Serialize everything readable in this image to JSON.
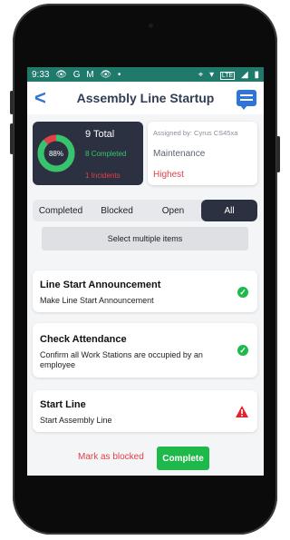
{
  "status_bar": {
    "time": "9:33",
    "left_icons": [
      "eye-icon",
      "google-icon",
      "gmail-icon",
      "eye-icon",
      "dot"
    ],
    "right_icons": [
      "location-icon",
      "wifi-icon",
      "lte-icon",
      "signal-icon",
      "battery-icon"
    ],
    "left_glyphs": [
      "👁",
      "G",
      "M",
      "👁",
      "•"
    ],
    "right_glyphs": [
      "⌖",
      "▾",
      "LTE",
      "◢",
      "▮"
    ]
  },
  "header": {
    "title": "Assembly Line Startup",
    "back_glyph": "<"
  },
  "stats": {
    "percent": "88%",
    "progress_fraction": 0.88,
    "total": "9 Total",
    "completed": "8 Completed",
    "incidents": "1 Incidents",
    "colors": {
      "complete": "#37c46e",
      "remaining": "#e0414a",
      "card": "#2c3141"
    }
  },
  "info": {
    "assigned": "Assigned by: Cyrus CS45xa",
    "category": "Maintenance",
    "priority": "Highest"
  },
  "tabs": [
    {
      "label": "Completed",
      "active": false
    },
    {
      "label": "Blocked",
      "active": false
    },
    {
      "label": "Open",
      "active": false
    },
    {
      "label": "All",
      "active": true
    }
  ],
  "select_multiple": "Select multiple items",
  "tasks": [
    {
      "title": "Line Start Announcement",
      "desc": "Make Line Start Announcement",
      "status": "done",
      "icon": "check-icon"
    },
    {
      "title": "Check Attendance",
      "desc": "Confirm all Work Stations are occupied by an employee",
      "status": "done",
      "icon": "check-icon"
    },
    {
      "title": "Start Line",
      "desc": "Start Assembly Line",
      "status": "warning",
      "icon": "warning-icon"
    }
  ],
  "actions": {
    "mark_blocked": "Mark as blocked",
    "complete": "Complete"
  }
}
